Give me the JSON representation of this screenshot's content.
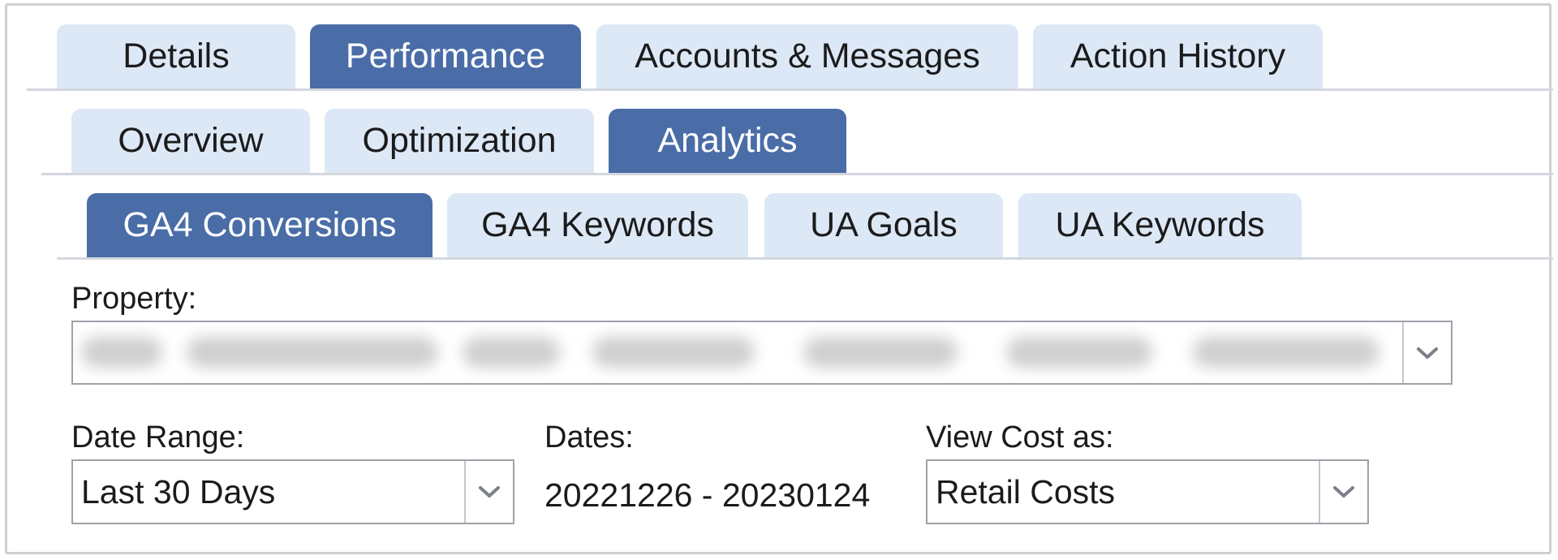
{
  "tabs_level1": {
    "items": [
      {
        "label": "Details",
        "active": false
      },
      {
        "label": "Performance",
        "active": true
      },
      {
        "label": "Accounts & Messages",
        "active": false
      },
      {
        "label": "Action History",
        "active": false
      }
    ]
  },
  "tabs_level2": {
    "items": [
      {
        "label": "Overview",
        "active": false
      },
      {
        "label": "Optimization",
        "active": false
      },
      {
        "label": "Analytics",
        "active": true
      }
    ]
  },
  "tabs_level3": {
    "items": [
      {
        "label": "GA4 Conversions",
        "active": true
      },
      {
        "label": "GA4 Keywords",
        "active": false
      },
      {
        "label": "UA Goals",
        "active": false
      },
      {
        "label": "UA Keywords",
        "active": false
      }
    ]
  },
  "property": {
    "label": "Property:",
    "value": "",
    "value_obscured": true,
    "icon": "chevron-down-icon"
  },
  "date_range": {
    "label": "Date Range:",
    "value": "Last 30 Days",
    "icon": "chevron-down-icon"
  },
  "dates": {
    "label": "Dates:",
    "value": "20221226 - 20230124"
  },
  "view_cost": {
    "label": "View Cost as:",
    "value": "Retail Costs",
    "icon": "chevron-down-icon"
  },
  "colors": {
    "active_tab": "#4a6da8",
    "inactive_tab": "#dde8f6",
    "border": "#9ea3aa"
  }
}
